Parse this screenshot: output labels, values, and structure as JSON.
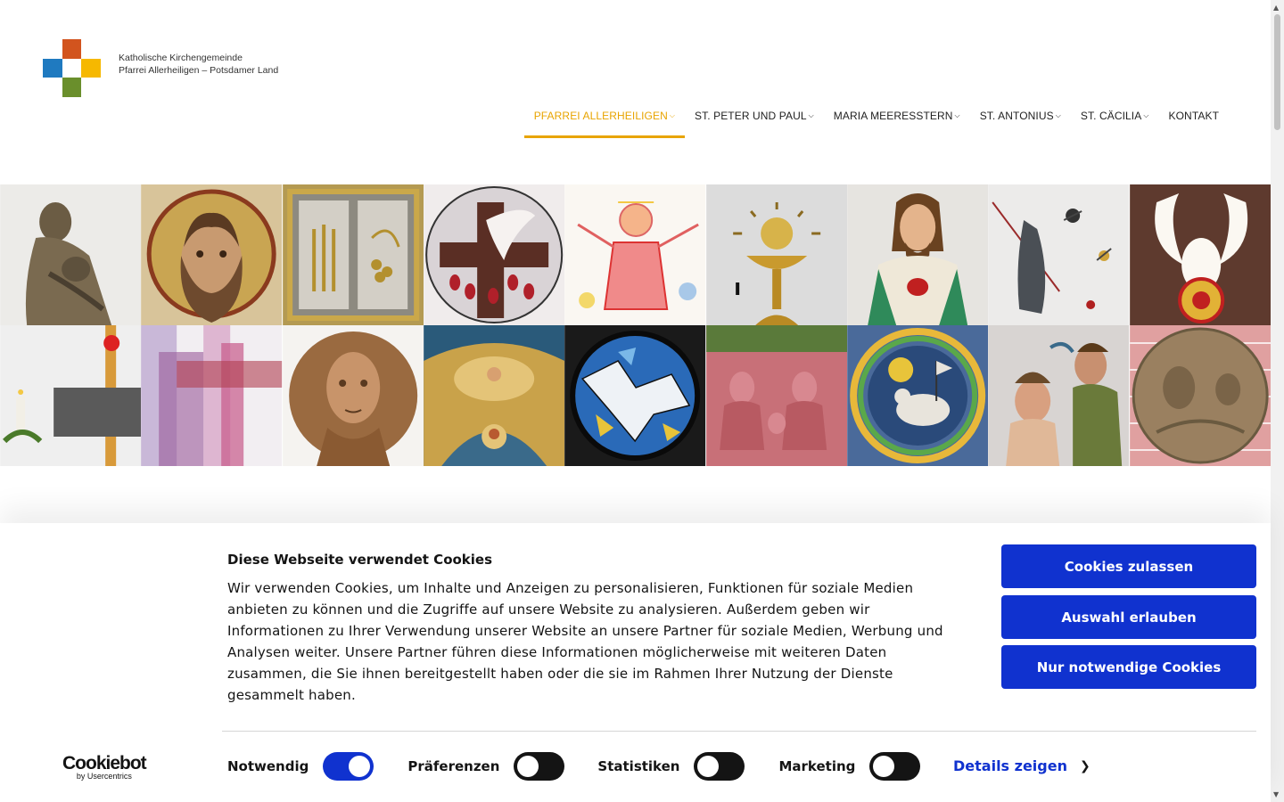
{
  "header": {
    "logo_line1": "Katholische Kirchengemeinde",
    "logo_line2": "Pfarrei Allerheiligen – Potsdamer Land",
    "logo_colors": [
      "#d2541e",
      "#1f7ac0",
      "#f6b800",
      "#6a8f2c",
      "#ffffff"
    ]
  },
  "nav": {
    "items": [
      {
        "label": "PFARREI ALLERHEILIGEN",
        "dropdown": true,
        "active": true
      },
      {
        "label": "ST. PETER UND PAUL",
        "dropdown": true
      },
      {
        "label": "MARIA MEERESSTERN",
        "dropdown": true
      },
      {
        "label": "ST. ANTONIUS",
        "dropdown": true
      },
      {
        "label": "ST. CÄCILIA",
        "dropdown": true
      },
      {
        "label": "KONTAKT",
        "dropdown": false
      }
    ],
    "accent_color": "#e8a400"
  },
  "gallery": {
    "tiles": [
      "madonna-sculpture-icon",
      "saint-mosaic-icon",
      "tabernacle-door-icon",
      "dove-stained-glass-icon",
      "child-drawing-icon",
      "chalice-icon",
      "sacred-heart-statue-icon",
      "wall-art-icon",
      "holy-spirit-dove-icon",
      "altar-candle-icon",
      "abstract-cross-icon",
      "wooden-bust-icon",
      "apse-mosaic-icon",
      "dove-window-icon",
      "relief-scene-icon",
      "lamb-mosaic-icon",
      "baptism-sculpture-icon",
      "bronze-medallion-icon"
    ]
  },
  "cookie_banner": {
    "title": "Diese Webseite verwendet Cookies",
    "text": "Wir verwenden Cookies, um Inhalte und Anzeigen zu personalisieren, Funktionen für soziale Medien anbieten zu können und die Zugriffe auf unsere Website zu analysieren. Außerdem geben wir Informationen zu Ihrer Verwendung unserer Website an unsere Partner für soziale Medien, Werbung und Analysen weiter. Unsere Partner führen diese Informationen möglicherweise mit weiteren Daten zusammen, die Sie ihnen bereitgestellt haben oder die sie im Rahmen Ihrer Nutzung der Dienste gesammelt haben.",
    "buttons": {
      "allow_all": "Cookies zulassen",
      "allow_selection": "Auswahl erlauben",
      "necessary_only": "Nur notwendige Cookies"
    },
    "toggles": [
      {
        "label": "Notwendig",
        "checked": true
      },
      {
        "label": "Präferenzen",
        "checked": false
      },
      {
        "label": "Statistiken",
        "checked": false
      },
      {
        "label": "Marketing",
        "checked": false
      }
    ],
    "details_label": "Details zeigen",
    "brand_main": "Cookiebot",
    "brand_sub": "by Usercentrics",
    "button_color": "#1032cf"
  }
}
